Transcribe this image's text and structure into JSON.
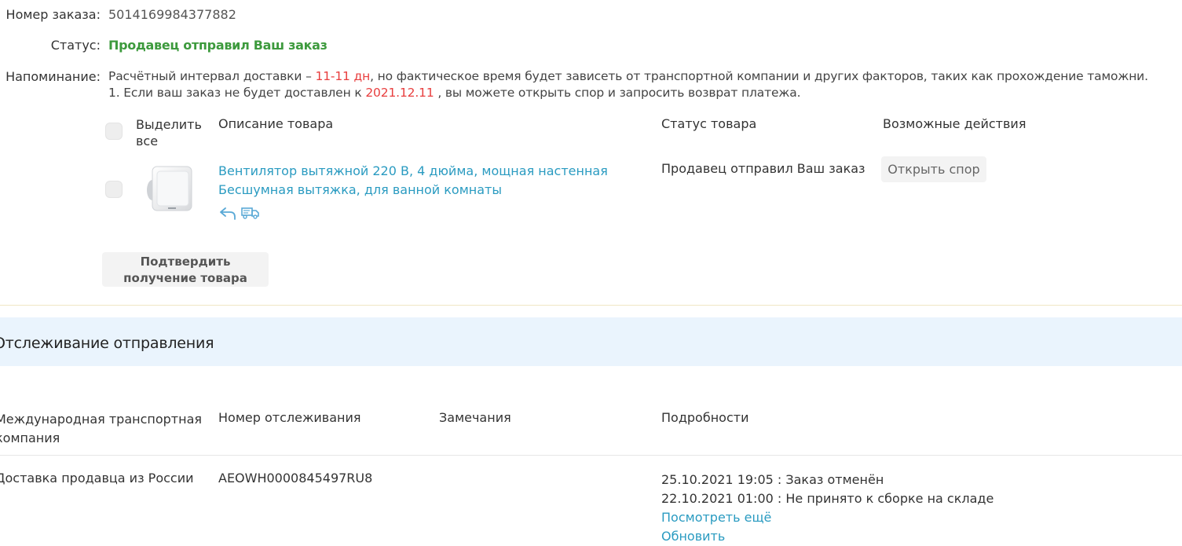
{
  "order": {
    "number_label": "Номер заказа:",
    "number_value": "5014169984377882",
    "status_label": "Статус:",
    "status_value": "Продавец отправил Ваш заказ",
    "reminder_label": "Напоминание:",
    "reminder_line1_a": "Расчётный интервал доставки –",
    "reminder_line1_days": "11-11 дн",
    "reminder_line1_b": ", но фактическое время будет зависеть от транспортной компании и других факторов, таких как прохождение таможни.",
    "reminder_line2_a": "1. Если ваш заказ не будет доставлен к",
    "reminder_line2_date": "2021.12.11",
    "reminder_line2_b": ", вы можете открыть спор и запросить возврат платежа."
  },
  "items_table": {
    "select_all_line1": "Выделить",
    "select_all_line2": "все",
    "col_description": "Описание товара",
    "col_status": "Статус товара",
    "col_actions": "Возможные действия",
    "items": [
      {
        "title_line1": "Вентилятор вытяжной 220 В, 4 дюйма, мощная настенная",
        "title_line2": "Бесшумная вытяжка, для ванной комнаты",
        "status": "Продавец отправил Ваш заказ",
        "action": "Открыть спор",
        "icons": [
          "return-arrow-icon",
          "delivery-truck-icon"
        ]
      }
    ],
    "confirm_line1": "Подтвердить",
    "confirm_line2": "получение товара"
  },
  "tracking": {
    "title": "Отслеживание отправления",
    "col_company_line1": "Международная транспортная",
    "col_company_line2": "компания",
    "col_number": "Номер отслеживания",
    "col_remarks": "Замечания",
    "col_details": "Подробности",
    "rows": [
      {
        "company": "Доставка продавца из России",
        "number": "AEOWH0000845497RU8",
        "remarks": "",
        "events": [
          "25.10.2021 19:05 : Заказ отменён",
          "22.10.2021 01:00 : Не принято к сборке на складе"
        ],
        "more_link": "Посмотреть ещё",
        "refresh_link": "Обновить"
      }
    ]
  },
  "colors": {
    "status_green": "#3d9a3d",
    "highlight_red": "#e83e3e",
    "link_blue": "#2a9bc1",
    "tracking_band": "#eaf4fd"
  }
}
